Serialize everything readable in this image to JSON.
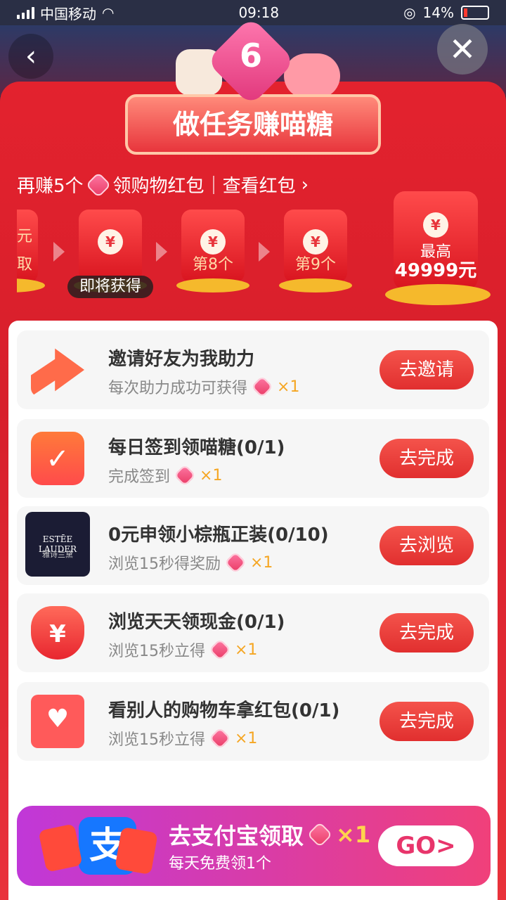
{
  "status_bar": {
    "carrier": "中国移动",
    "time": "09:18",
    "battery": "14%"
  },
  "header": {
    "badge_number": "6",
    "title": "做任务赚喵糖"
  },
  "progress": {
    "text_prefix": "再赚5个",
    "text_suffix": "领购物红包",
    "link": "查看红包"
  },
  "rewards": [
    {
      "label": "元",
      "sub": "取"
    },
    {
      "label": "",
      "tag": "即将获得"
    },
    {
      "label": "第8个"
    },
    {
      "label": "第9个"
    }
  ],
  "top_reward": {
    "line1": "最高",
    "amount": "49999元",
    "coin": "¥"
  },
  "tasks": [
    {
      "title": "邀请好友为我助力",
      "sub": "每次助力成功可获得",
      "multiplier": "×1",
      "button": "去邀请",
      "icon": "share-arrow-icon"
    },
    {
      "title": "每日签到领喵糖(0/1)",
      "sub": "完成签到",
      "multiplier": "×1",
      "button": "去完成",
      "icon": "calendar-check-icon"
    },
    {
      "title": "0元申领小棕瓶正装(0/10)",
      "sub": "浏览15秒得奖励",
      "multiplier": "×1",
      "button": "去浏览",
      "icon": "estee-lauder-logo"
    },
    {
      "title": "浏览天天领现金(0/1)",
      "sub": "浏览15秒立得",
      "multiplier": "×1",
      "button": "去完成",
      "icon": "money-bag-icon"
    },
    {
      "title": "看别人的购物车拿红包(0/1)",
      "sub": "浏览15秒立得",
      "multiplier": "×1",
      "button": "去完成",
      "icon": "shopping-cart-heart-icon"
    }
  ],
  "estee": {
    "brand": "ESTĒE LAUDER",
    "cn": "雅诗兰黛"
  },
  "alipay_banner": {
    "title": "去支付宝领取",
    "multiplier": "×1",
    "sub": "每天免费领1个",
    "go": "GO>",
    "logo_char": "支"
  },
  "colors": {
    "primary_red": "#e3222e",
    "button_red": "#e12f2f",
    "gold": "#f5b92c",
    "alipay_blue": "#1677ff"
  }
}
